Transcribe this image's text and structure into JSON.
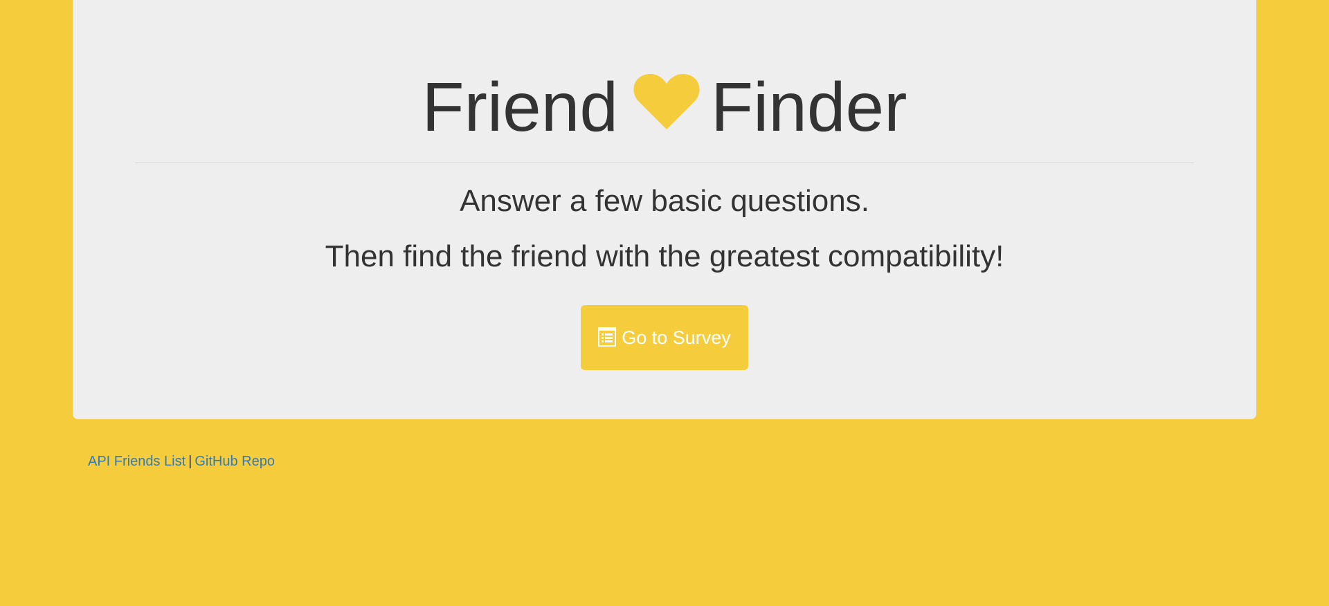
{
  "colors": {
    "page_background": "#f5cd3c",
    "jumbotron_background": "#eeeeee",
    "text": "#333333",
    "accent": "#f5cd3c",
    "link": "#337ab7"
  },
  "header": {
    "title_left": "Friend",
    "title_right": "Finder",
    "title_icon": "heart-icon"
  },
  "intro": {
    "line1": "Answer a few basic questions.",
    "line2": "Then find the friend with the greatest compatibility!"
  },
  "survey_button": {
    "label": "Go to Survey",
    "icon": "list-alt-icon"
  },
  "footer": {
    "api_link_label": "API Friends List",
    "separator": "|",
    "github_link_label": "GitHub Repo"
  }
}
